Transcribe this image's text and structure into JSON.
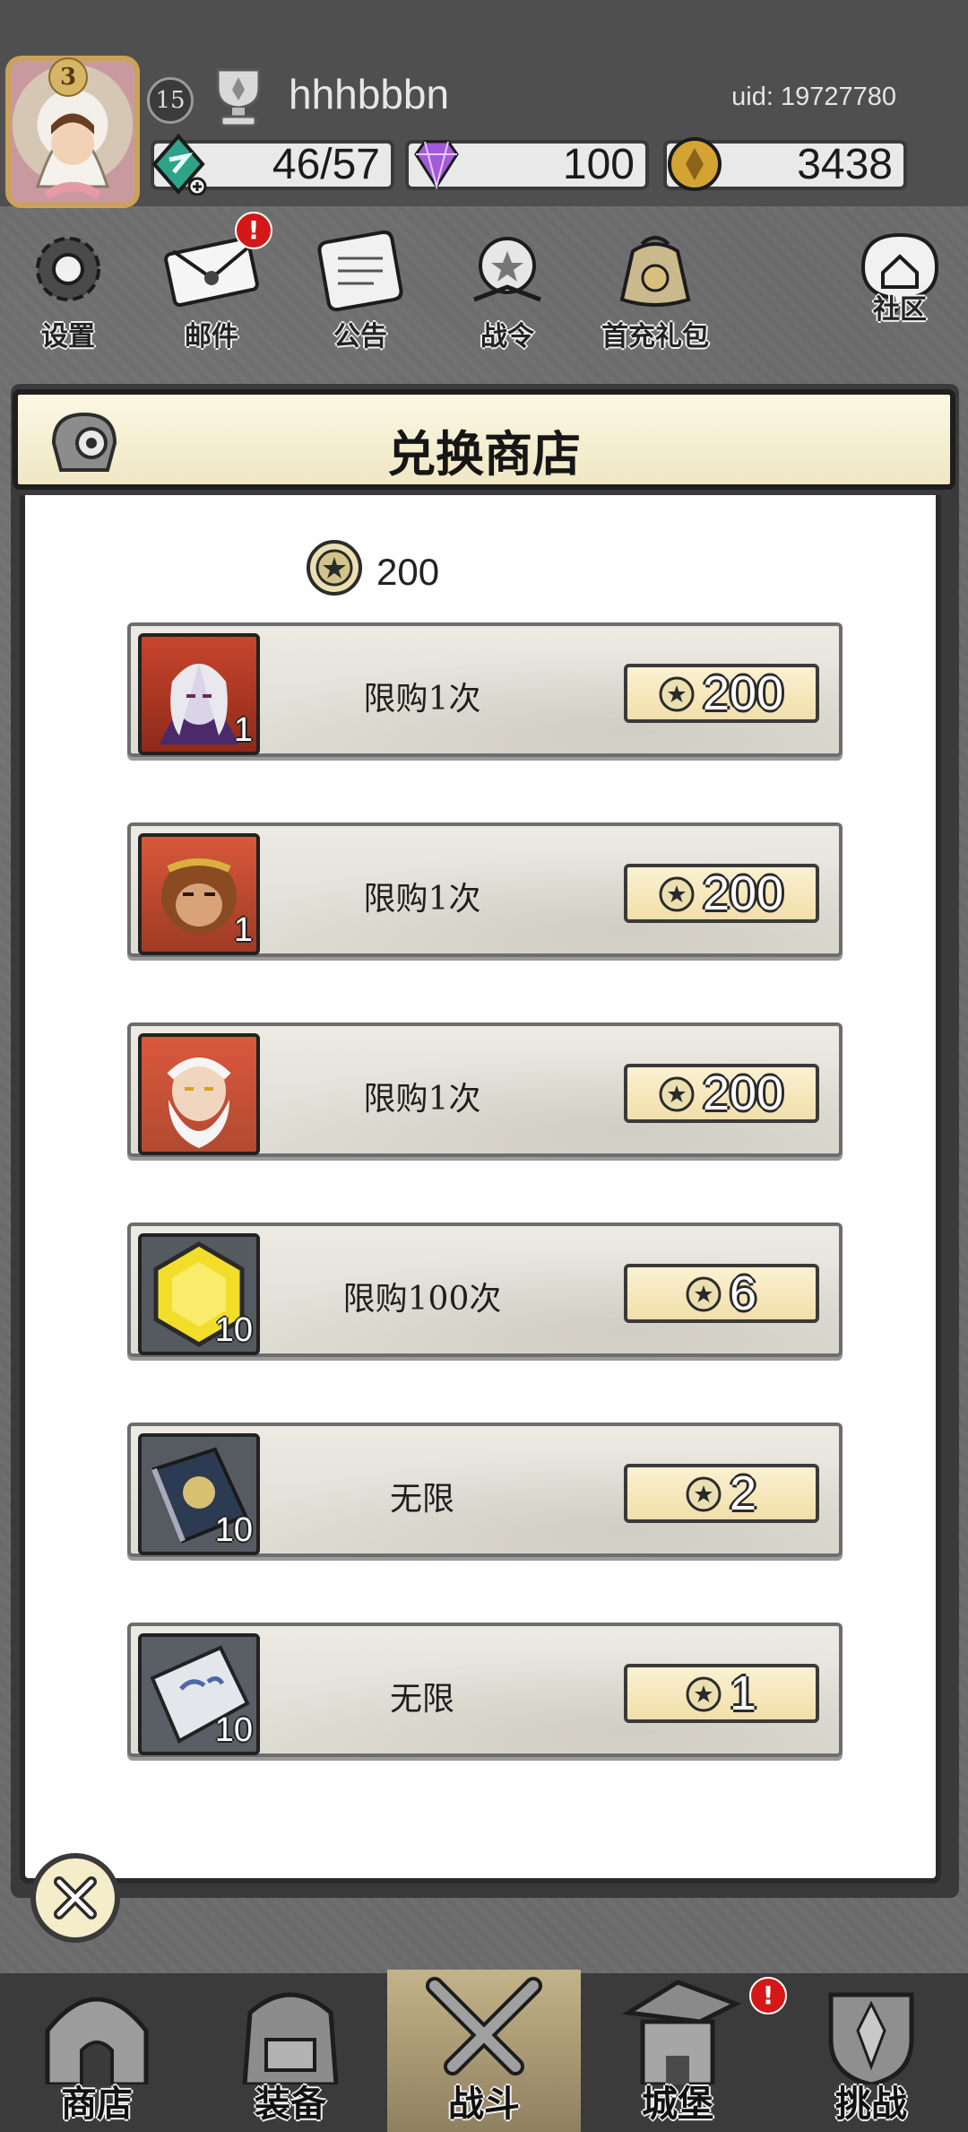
{
  "header": {
    "player_level": "3",
    "account_level": "15",
    "username": "hhhbbbn",
    "uid": "uid: 19727780",
    "stamina": "46/57",
    "gems": "100",
    "gold": "3438"
  },
  "top_menu": [
    {
      "label": "设置",
      "icon": "gear-icon"
    },
    {
      "label": "邮件",
      "icon": "mail-icon",
      "badge": "!"
    },
    {
      "label": "公告",
      "icon": "scroll-icon"
    },
    {
      "label": "战令",
      "icon": "battle-pass-icon"
    },
    {
      "label": "首充礼包",
      "icon": "gift-bag-icon"
    },
    {
      "label": "社区",
      "icon": "community-icon"
    }
  ],
  "panel": {
    "title": "兑换商店",
    "balance": "200"
  },
  "shop_items": [
    {
      "count": "1",
      "limit": "限购1次",
      "price": "200",
      "icon": "hero-portrait-elf-icon"
    },
    {
      "count": "1",
      "limit": "限购1次",
      "price": "200",
      "icon": "hero-portrait-monkey-icon"
    },
    {
      "count": "",
      "limit": "限购1次",
      "price": "200",
      "icon": "hero-portrait-sage-icon"
    },
    {
      "count": "10",
      "limit": "限购100次",
      "price": "6",
      "icon": "yellow-gem-icon"
    },
    {
      "count": "10",
      "limit": "无限",
      "price": "2",
      "icon": "spell-book-icon"
    },
    {
      "count": "10",
      "limit": "无限",
      "price": "1",
      "icon": "silver-ingot-icon"
    }
  ],
  "bottom_nav": [
    {
      "label": "商店",
      "icon": "shop-hut-icon"
    },
    {
      "label": "装备",
      "icon": "backpack-icon"
    },
    {
      "label": "战斗",
      "icon": "crossed-swords-icon",
      "active": true
    },
    {
      "label": "城堡",
      "icon": "castle-icon",
      "badge": "!"
    },
    {
      "label": "挑战",
      "icon": "shield-trophy-icon"
    }
  ]
}
